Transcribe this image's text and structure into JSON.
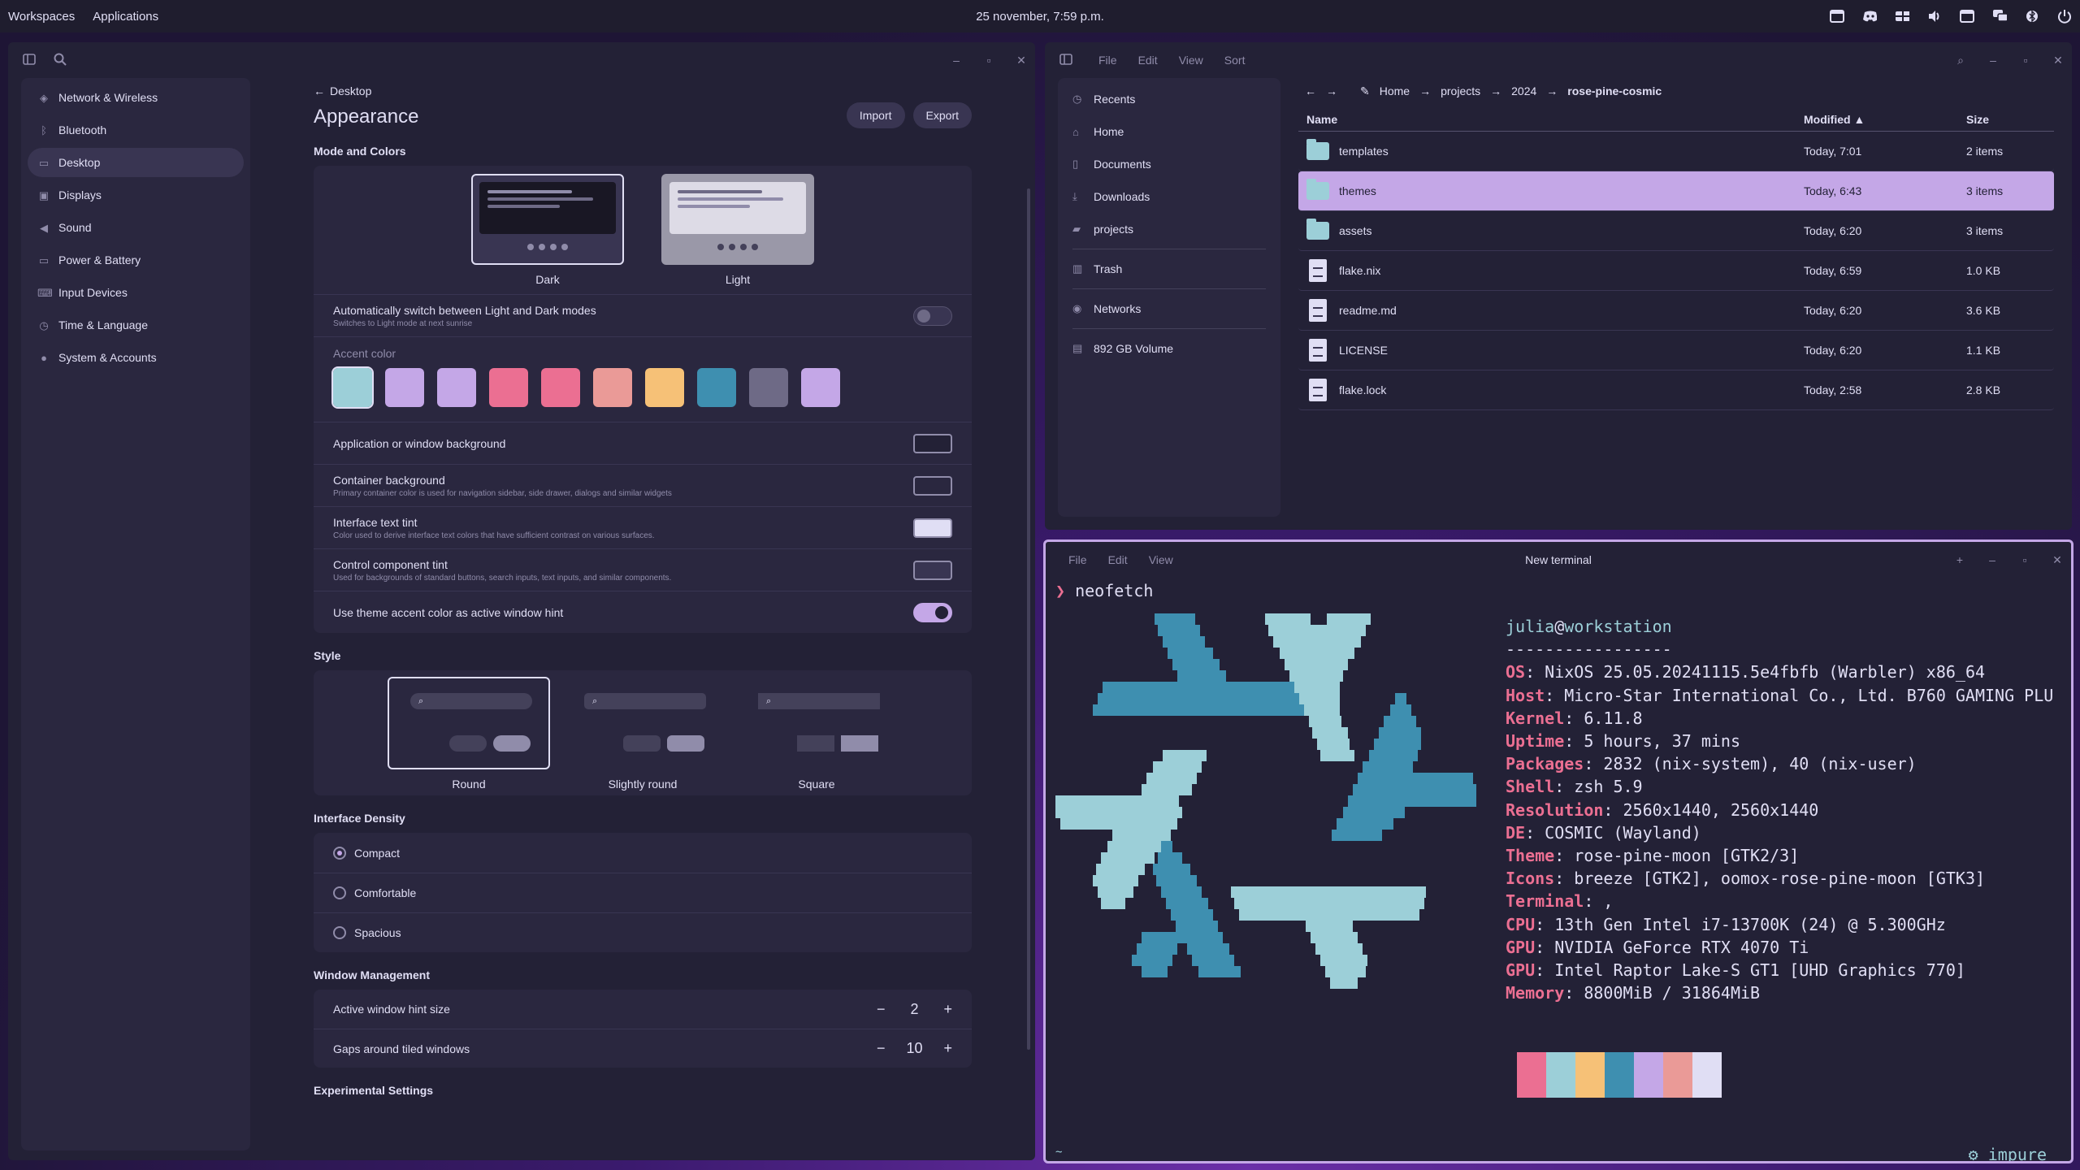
{
  "panel": {
    "workspaces": "Workspaces",
    "applications": "Applications",
    "clock": "25 november, 7:59 p.m.",
    "tray": [
      "window-icon",
      "discord-icon",
      "grid-icon",
      "volume-icon",
      "display-icon",
      "mail-icon",
      "bluetooth-icon",
      "power-icon"
    ]
  },
  "settings": {
    "sidebar": [
      "Network & Wireless",
      "Bluetooth",
      "Desktop",
      "Displays",
      "Sound",
      "Power & Battery",
      "Input Devices",
      "Time & Language",
      "System & Accounts"
    ],
    "crumb": "Desktop",
    "title": "Appearance",
    "import": "Import",
    "export": "Export",
    "mode_title": "Mode and Colors",
    "dark": "Dark",
    "light": "Light",
    "auto_switch": "Automatically switch between Light and Dark modes",
    "auto_switch_desc": "Switches to Light mode at next sunrise",
    "accent_title": "Accent color",
    "accents": [
      "#9ccfd8",
      "#c4a7e7",
      "#c4a7e7",
      "#eb6f92",
      "#eb6f92",
      "#ea9a97",
      "#f6c177",
      "#3e8fb0",
      "#6e6a86",
      "#c4a7e7"
    ],
    "app_bg": "Application or window background",
    "container_bg": "Container background",
    "container_bg_desc": "Primary container color is used for navigation sidebar, side drawer, dialogs and similar widgets",
    "text_tint": "Interface text tint",
    "text_tint_desc": "Color used to derive interface text colors that have sufficient contrast on various surfaces.",
    "control_tint": "Control component tint",
    "control_tint_desc": "Used for backgrounds of standard buttons, search inputs, text inputs, and similar components.",
    "accent_hint": "Use theme accent color as active window hint",
    "style_title": "Style",
    "style_round": "Round",
    "style_slight": "Slightly round",
    "style_square": "Square",
    "density_title": "Interface Density",
    "density": [
      "Compact",
      "Comfortable",
      "Spacious"
    ],
    "wm_title": "Window Management",
    "hint_size": "Active window hint size",
    "hint_size_val": "2",
    "gaps": "Gaps around tiled windows",
    "gaps_val": "10",
    "experimental": "Experimental Settings"
  },
  "files": {
    "menu": [
      "File",
      "Edit",
      "View",
      "Sort"
    ],
    "sidebar": [
      "Recents",
      "Home",
      "Documents",
      "Downloads",
      "projects",
      "Trash",
      "Networks",
      "892 GB Volume"
    ],
    "path": [
      "Home",
      "projects",
      "2024",
      "rose-pine-cosmic"
    ],
    "cols": [
      "Name",
      "Modified",
      "Size"
    ],
    "rows": [
      {
        "name": "templates",
        "mod": "Today, 7:01",
        "size": "2 items",
        "type": "folder"
      },
      {
        "name": "themes",
        "mod": "Today, 6:43",
        "size": "3 items",
        "type": "folder"
      },
      {
        "name": "assets",
        "mod": "Today, 6:20",
        "size": "3 items",
        "type": "folder"
      },
      {
        "name": "flake.nix",
        "mod": "Today, 6:59",
        "size": "1.0 KB",
        "type": "file"
      },
      {
        "name": "readme.md",
        "mod": "Today, 6:20",
        "size": "3.6 KB",
        "type": "file"
      },
      {
        "name": "LICENSE",
        "mod": "Today, 6:20",
        "size": "1.1 KB",
        "type": "file"
      },
      {
        "name": "flake.lock",
        "mod": "Today, 2:58",
        "size": "2.8 KB",
        "type": "file"
      }
    ]
  },
  "terminal": {
    "menu": [
      "File",
      "Edit",
      "View"
    ],
    "title": "New terminal",
    "command": "neofetch",
    "user": "julia",
    "host": "workstation",
    "sep": "-----------------",
    "info": [
      [
        "OS",
        "NixOS 25.05.20241115.5e4fbfb (Warbler) x86_64"
      ],
      [
        "Host",
        "Micro-Star International Co., Ltd. B760 GAMING PLU"
      ],
      [
        "Kernel",
        "6.11.8"
      ],
      [
        "Uptime",
        "5 hours, 37 mins"
      ],
      [
        "Packages",
        "2832 (nix-system), 40 (nix-user)"
      ],
      [
        "Shell",
        "zsh 5.9"
      ],
      [
        "Resolution",
        "2560x1440, 2560x1440"
      ],
      [
        "DE",
        "COSMIC (Wayland)"
      ],
      [
        "Theme",
        "rose-pine-moon [GTK2/3]"
      ],
      [
        "Icons",
        "breeze [GTK2], oomox-rose-pine-moon [GTK3]"
      ],
      [
        "Terminal",
        ","
      ],
      [
        "CPU",
        "13th Gen Intel i7-13700K (24) @ 5.300GHz"
      ],
      [
        "GPU",
        "NVIDIA GeForce RTX 4070 Ti"
      ],
      [
        "GPU",
        "Intel Raptor Lake-S GT1 [UHD Graphics 770]"
      ],
      [
        "Memory",
        "8800MiB / 31864MiB"
      ]
    ],
    "palette": [
      "#eb6f92",
      "#9ccfd8",
      "#f6c177",
      "#3e8fb0",
      "#c4a7e7",
      "#ea9a97",
      "#e0def4"
    ],
    "right_prompt": "impure",
    "tilde": "~"
  }
}
